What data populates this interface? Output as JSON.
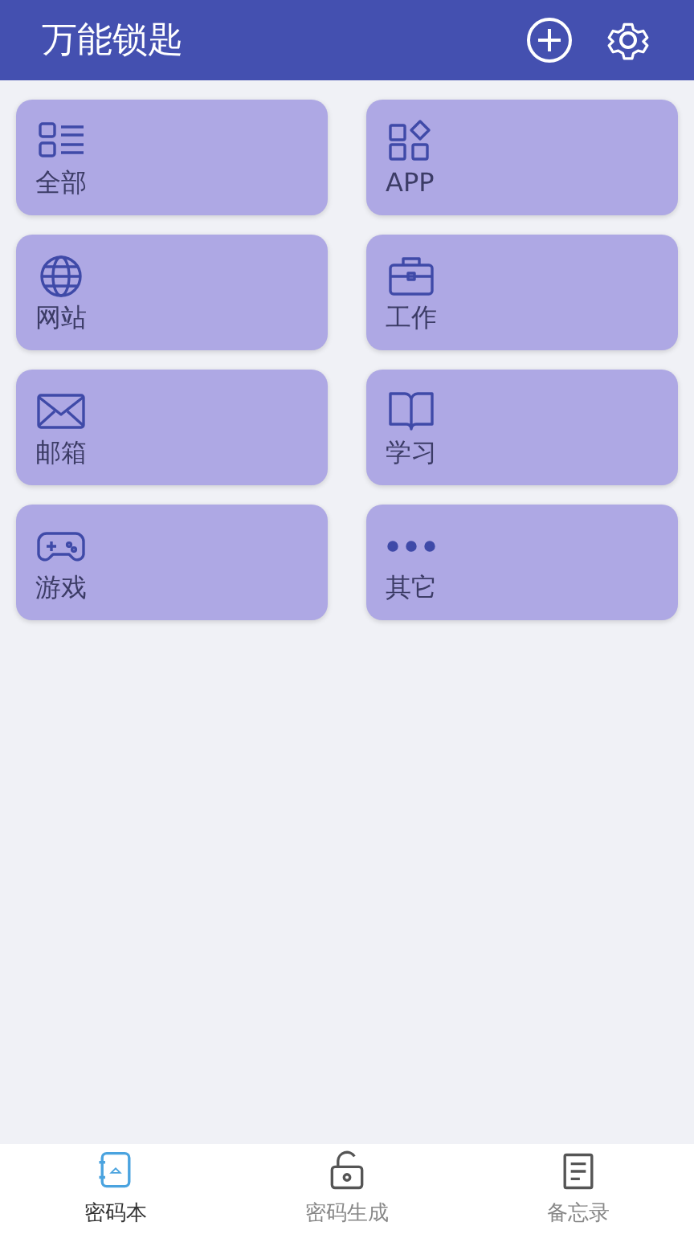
{
  "header": {
    "title": "万能锁匙"
  },
  "categories": [
    {
      "kind": "all",
      "label": "全部"
    },
    {
      "kind": "app",
      "label": "APP"
    },
    {
      "kind": "web",
      "label": "网站"
    },
    {
      "kind": "work",
      "label": "工作"
    },
    {
      "kind": "mail",
      "label": "邮箱"
    },
    {
      "kind": "study",
      "label": "学习"
    },
    {
      "kind": "game",
      "label": "游戏"
    },
    {
      "kind": "other",
      "label": "其它"
    }
  ],
  "bottom_nav": [
    {
      "kind": "book",
      "label": "密码本",
      "selected": true
    },
    {
      "kind": "lock",
      "label": "密码生成",
      "selected": false
    },
    {
      "kind": "memo",
      "label": "备忘录",
      "selected": false
    }
  ]
}
